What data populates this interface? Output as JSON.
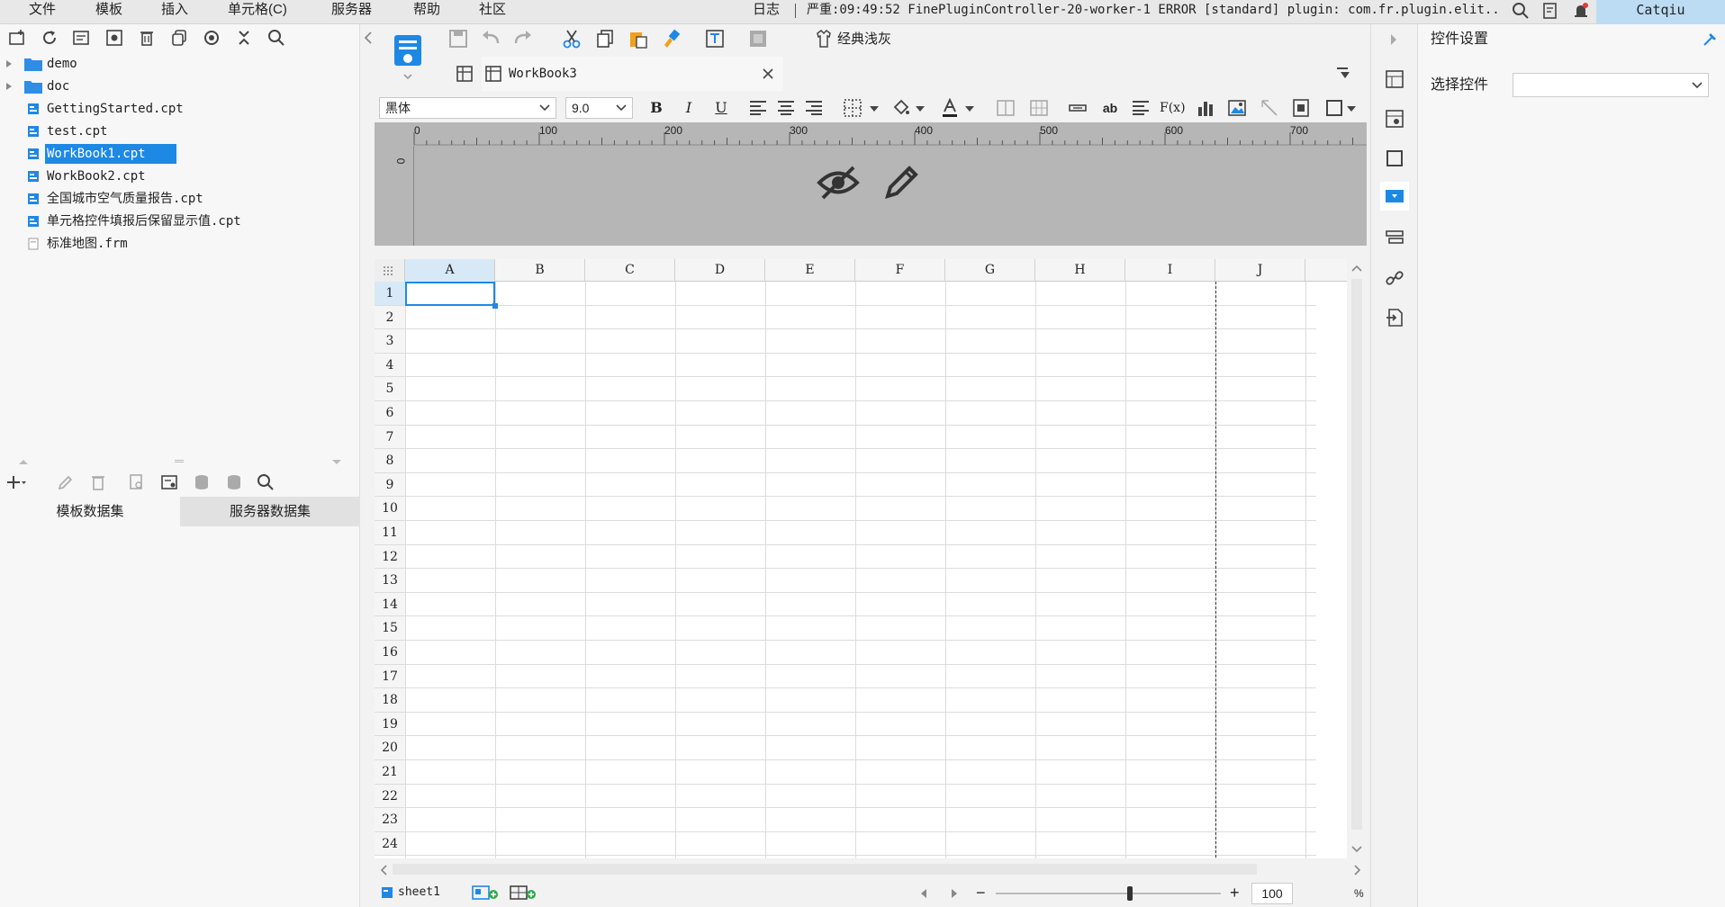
{
  "menubar": {
    "items": [
      "文件",
      "模板",
      "插入",
      "单元格(C)",
      "服务器",
      "帮助",
      "社区"
    ],
    "log_label": "日志",
    "log_message": "严重:09:49:52 FinePluginController-20-worker-1 ERROR [standard] plugin: com.fr.plugin.elit...",
    "user": "Catqiu"
  },
  "file_tree": {
    "items": [
      {
        "label": "demo",
        "type": "folder"
      },
      {
        "label": "doc",
        "type": "folder"
      },
      {
        "label": "GettingStarted.cpt",
        "type": "cpt"
      },
      {
        "label": "test.cpt",
        "type": "cpt"
      },
      {
        "label": "WorkBook1.cpt",
        "type": "cpt",
        "selected": true
      },
      {
        "label": "WorkBook2.cpt",
        "type": "cpt"
      },
      {
        "label": "全国城市空气质量报告.cpt",
        "type": "cpt"
      },
      {
        "label": "单元格控件填报后保留显示值.cpt",
        "type": "cpt"
      },
      {
        "label": "标准地图.frm",
        "type": "frm"
      }
    ]
  },
  "datasets": {
    "tab_template": "模板数据集",
    "tab_server": "服务器数据集"
  },
  "toolbar": {
    "theme_label": "经典浅灰"
  },
  "document": {
    "tab_title": "WorkBook3"
  },
  "format": {
    "font_name": "黑体",
    "font_size": "9.0",
    "bold": "B",
    "italic": "I",
    "underline": "U",
    "wrap_label": "ab",
    "formula_label": "F(x)"
  },
  "ruler": {
    "ticks": [
      "0",
      "100",
      "200",
      "300",
      "400",
      "500",
      "600",
      "700"
    ],
    "vertical_tick": "0"
  },
  "sheet": {
    "columns": [
      "A",
      "B",
      "C",
      "D",
      "E",
      "F",
      "G",
      "H",
      "I",
      "J"
    ],
    "rows": [
      "1",
      "2",
      "3",
      "4",
      "5",
      "6",
      "7",
      "8",
      "9",
      "10",
      "11",
      "12",
      "13",
      "14",
      "15",
      "16",
      "17",
      "18",
      "19",
      "20",
      "21",
      "22",
      "23",
      "24"
    ],
    "selected_cell": "A1"
  },
  "bottom": {
    "sheet_tab": "sheet1",
    "zoom": "100",
    "zoom_unit": "%",
    "zoom_minus": "−",
    "zoom_plus": "+"
  },
  "right_panel": {
    "title": "控件设置",
    "select_label": "选择控件",
    "select_value": ""
  },
  "colors": {
    "selection": "#1e88e5",
    "ruler_bg": "#b6b6b6",
    "user_bg": "#bcdcf3"
  }
}
